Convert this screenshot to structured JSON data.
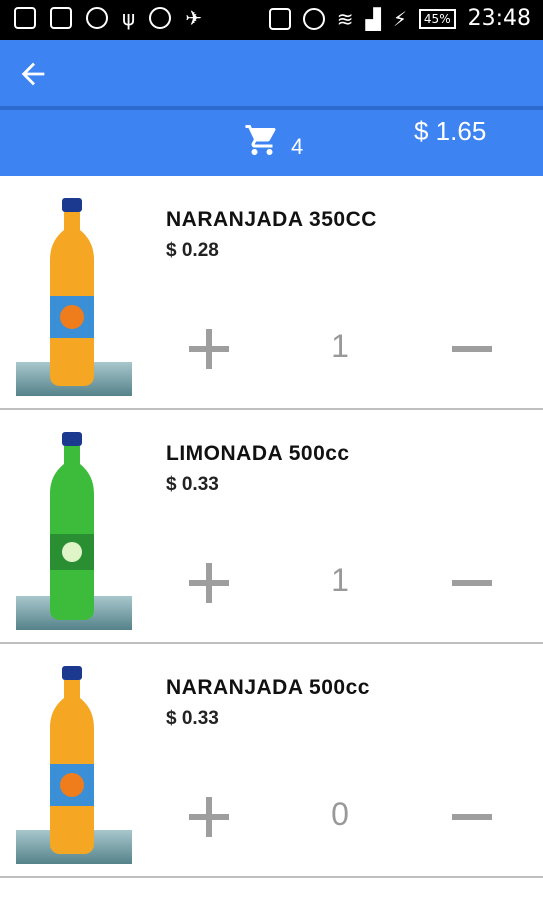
{
  "status_bar": {
    "time": "23:48",
    "battery": "45%",
    "icons": [
      "message-icon",
      "edit-icon",
      "globe-icon",
      "usb-icon",
      "skype-icon",
      "plane-icon",
      "cast-icon",
      "alarm-icon",
      "wifi-icon",
      "signal-icon",
      "charging-icon"
    ]
  },
  "app_bar": {
    "back_icon": "arrow-back-icon",
    "color": "#3d83f2"
  },
  "cart_bar": {
    "cart_icon": "shopping-cart-icon",
    "count": "4",
    "total": "$ 1.65"
  },
  "products": [
    {
      "name": "NARANJADA 350CC",
      "price": "$ 0.28",
      "quantity": "1",
      "bottle_color": "#f5a623"
    },
    {
      "name": "LIMONADA 500cc",
      "price": "$ 0.33",
      "quantity": "1",
      "bottle_color": "#3dbb3a"
    },
    {
      "name": "NARANJADA 500cc",
      "price": "$ 0.33",
      "quantity": "0",
      "bottle_color": "#f5a623"
    }
  ]
}
